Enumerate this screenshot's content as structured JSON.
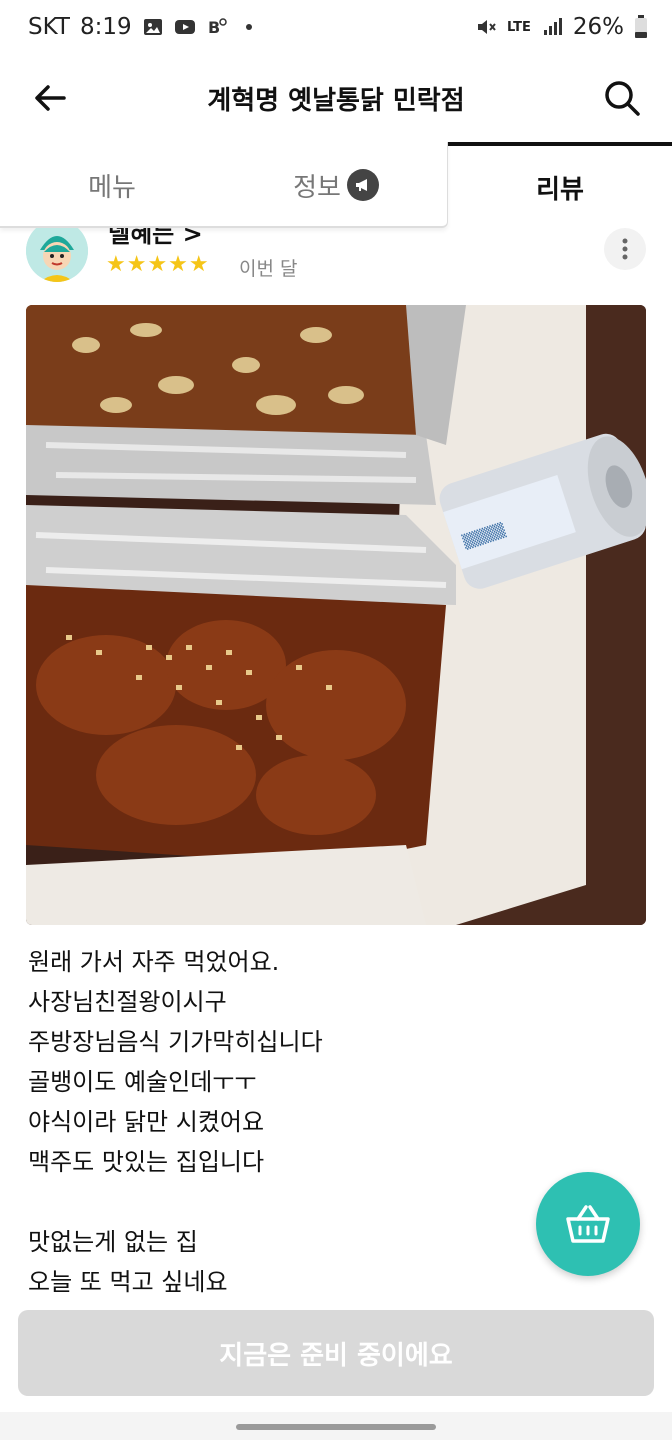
{
  "status_bar": {
    "carrier": "SKT",
    "time": "8:19",
    "network": "LTE",
    "battery": "26%"
  },
  "header": {
    "title": "계혁명 옛날통닭 민락점"
  },
  "tabs": [
    {
      "label": "메뉴",
      "active": false
    },
    {
      "label": "정보",
      "active": false
    },
    {
      "label": "리뷰",
      "active": true
    }
  ],
  "review": {
    "reviewer_name": "델혜는 >",
    "stars": "★★★★★",
    "date": "이번 달",
    "lines": [
      "원래 가서 자주 먹었어요.",
      "사장님친절왕이시구",
      "주방장님음식 기가막히십니다",
      "골뱅이도 예술인데ㅜㅜ",
      "야식이라 닭만 시켰어요",
      "맥주도 맛있는 집입니다",
      "",
      "맛없는게 없는 집",
      "오늘 또 먹고 싶네요"
    ]
  },
  "bottom_button": {
    "label": "지금은 준비 중이에요"
  },
  "colors": {
    "accent": "#2ec0b2",
    "disabled": "#d9d9d9",
    "star": "#f5c518"
  }
}
